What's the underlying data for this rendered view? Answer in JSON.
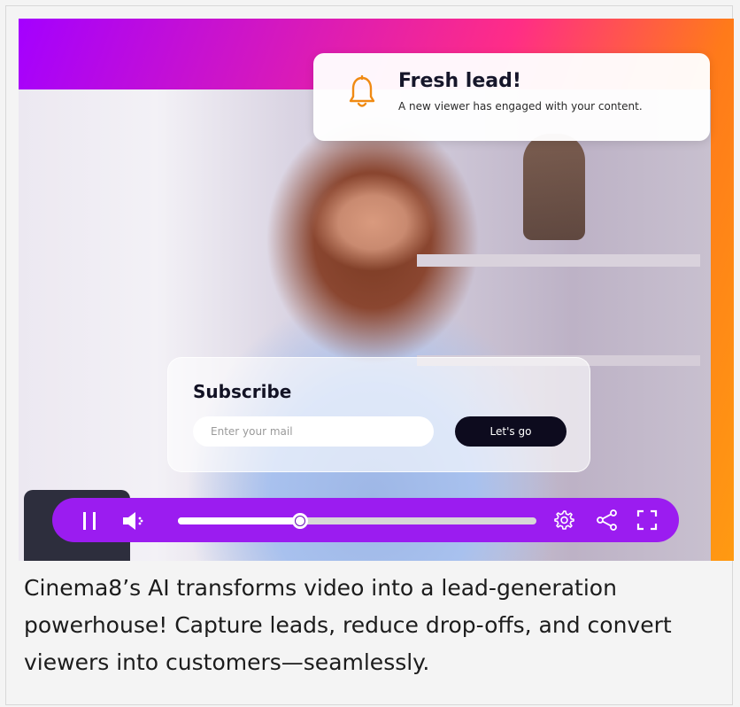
{
  "notification": {
    "title": "Fresh lead!",
    "message": "A new viewer has engaged with your content.",
    "icon": "bell-icon"
  },
  "subscribe": {
    "title": "Subscribe",
    "email_placeholder": "Enter your mail",
    "button_label": "Let's go"
  },
  "player": {
    "progress_fraction": 0.34,
    "icons": [
      "pause-icon",
      "volume-icon",
      "gear-icon",
      "share-icon",
      "fullscreen-icon"
    ],
    "colors": {
      "accent": "#9b1cf0",
      "notification_icon": "#f08a13"
    }
  },
  "caption": "Cinema8’s AI transforms video into a lead-generation powerhouse! Capture leads, reduce drop-offs, and convert viewers into customers—seamlessly."
}
